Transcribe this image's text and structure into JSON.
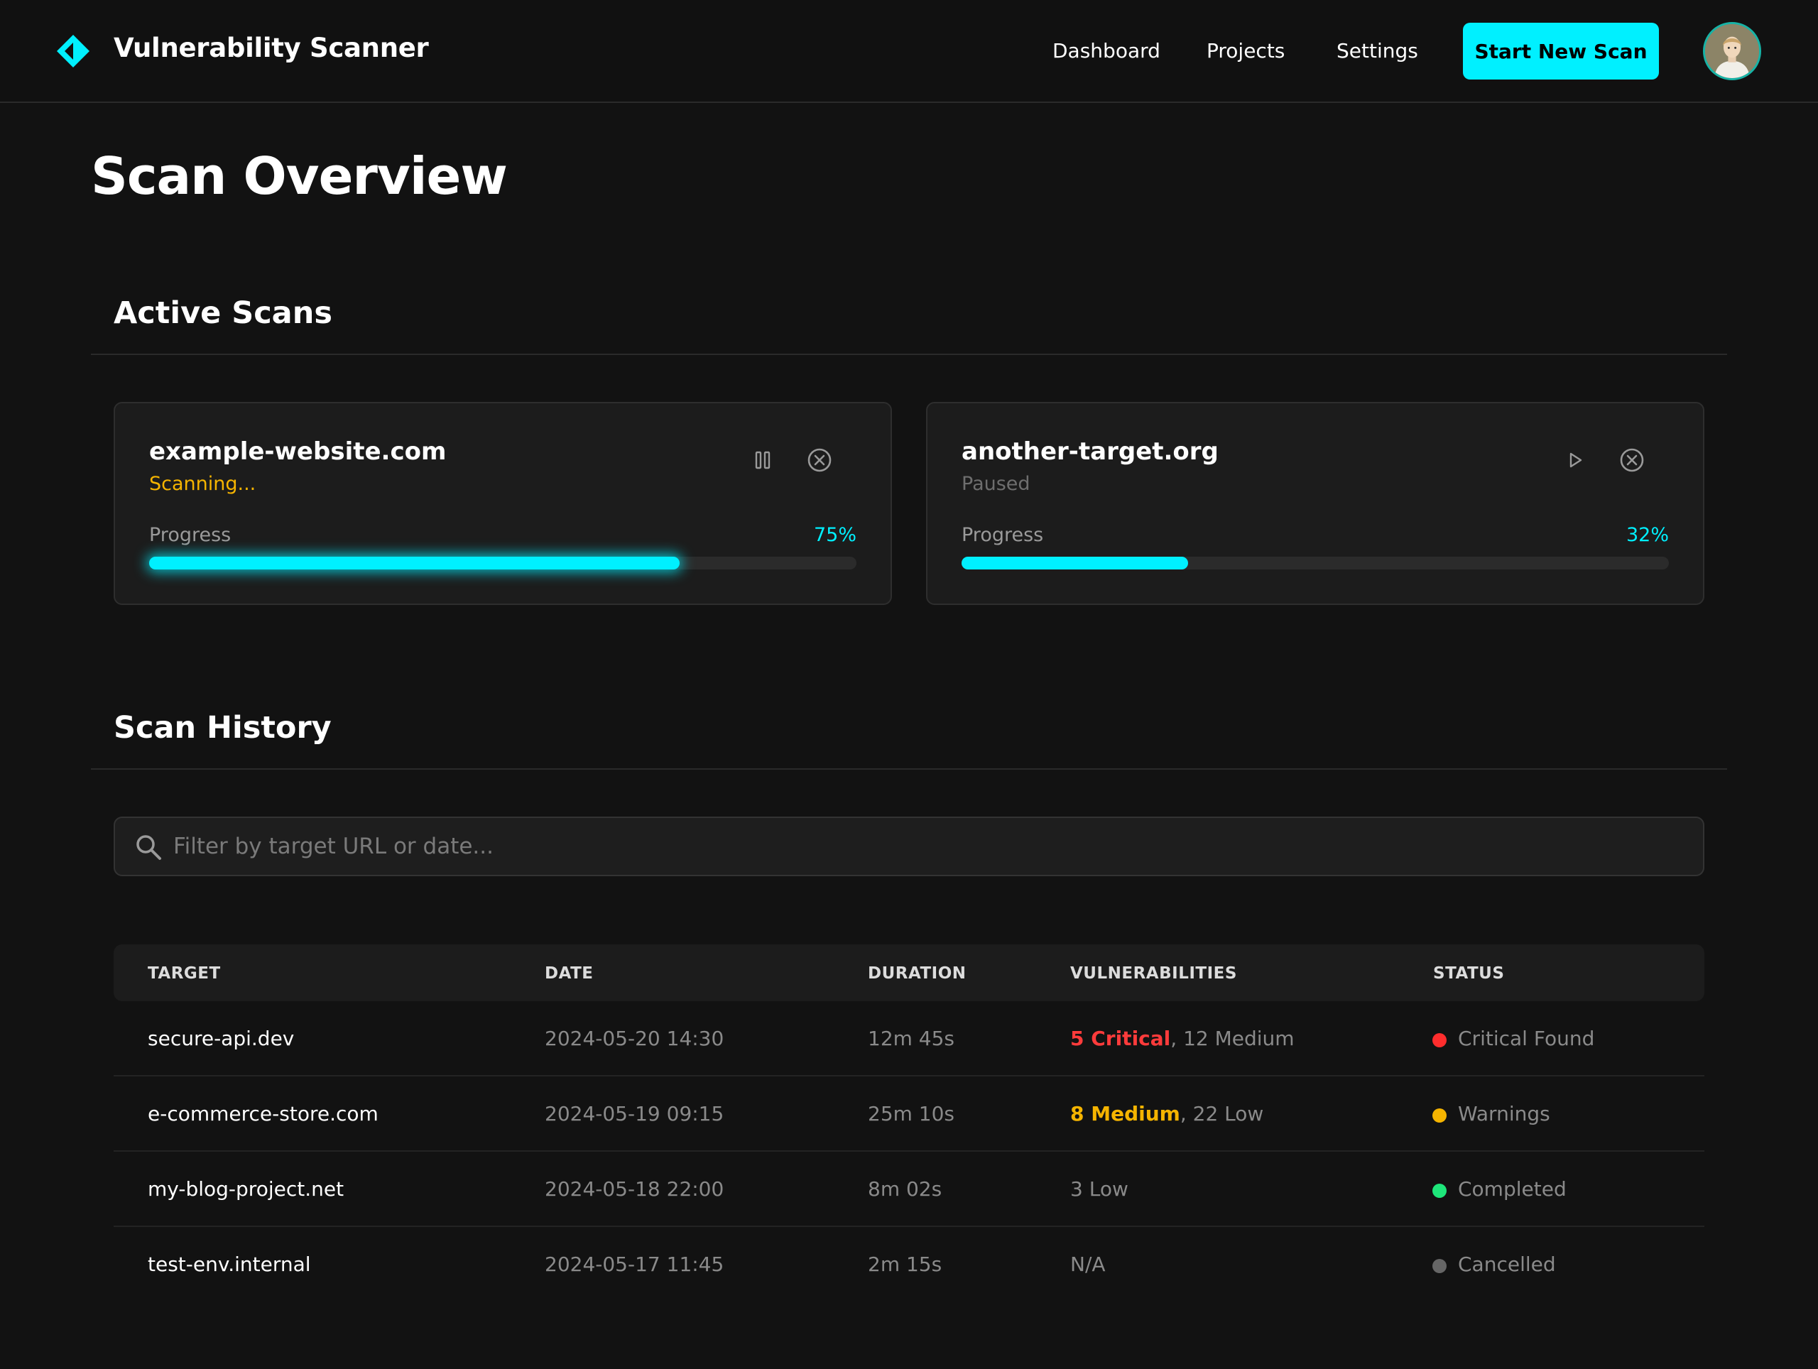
{
  "header": {
    "app_title": "Vulnerability Scanner",
    "nav": [
      "Dashboard",
      "Projects",
      "Settings"
    ],
    "cta_label": "Start New Scan",
    "brand_color": "#00f0ff"
  },
  "page_title": "Scan Overview",
  "active_scans": {
    "title": "Active Scans",
    "items": [
      {
        "target": "example-website.com",
        "status": "Scanning...",
        "progress_label": "Progress",
        "progress_text": "75%",
        "progress": 0.75,
        "actions": [
          "pause-icon",
          "cancel-icon"
        ]
      },
      {
        "target": "another-target.org",
        "status": "Paused",
        "progress_label": "Progress",
        "progress_text": "32%",
        "progress": 0.32,
        "actions": [
          "play-icon",
          "cancel-icon"
        ]
      }
    ]
  },
  "history": {
    "title": "Scan History",
    "search_placeholder": "Filter by target URL or date...",
    "columns": [
      "TARGET",
      "DATE",
      "DURATION",
      "VULNERABILITIES",
      "STATUS"
    ],
    "rows": [
      {
        "target": "secure-api.dev",
        "date": "2024-05-20 14:30",
        "duration": "12m 45s",
        "vuln_primary": "5 Critical",
        "vuln_sep": ", ",
        "vuln_secondary": "12 Medium",
        "vuln_color": "#ff3b3b",
        "status": "Critical Found",
        "status_color": "#ff2d2d"
      },
      {
        "target": "e-commerce-store.com",
        "date": "2024-05-19 09:15",
        "duration": "25m 10s",
        "vuln_primary": "8 Medium",
        "vuln_sep": ", ",
        "vuln_secondary": "22 Low",
        "vuln_color": "#f5b400",
        "status": "Warnings",
        "status_color": "#f5b400"
      },
      {
        "target": "my-blog-project.net",
        "date": "2024-05-18 22:00",
        "duration": "8m 02s",
        "vuln_primary": "",
        "vuln_sep": "",
        "vuln_secondary": "3 Low",
        "vuln_color": "#8a8a8a",
        "status": "Completed",
        "status_color": "#1ee67a"
      },
      {
        "target": "test-env.internal",
        "date": "2024-05-17 11:45",
        "duration": "2m 15s",
        "vuln_primary": "",
        "vuln_sep": "",
        "vuln_secondary": "N/A",
        "vuln_color": "#8a8a8a",
        "status": "Cancelled",
        "status_color": "#666666"
      }
    ]
  }
}
